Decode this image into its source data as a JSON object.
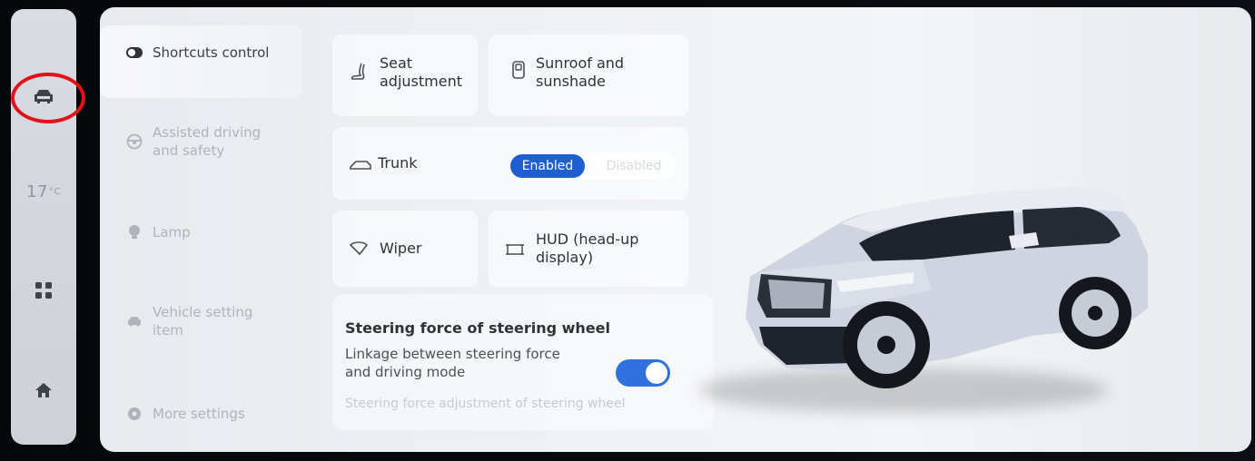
{
  "rail": {
    "temperature": "17",
    "temperature_unit": "°C",
    "items": [
      {
        "name": "car-icon",
        "selected": true
      },
      {
        "name": "temperature"
      },
      {
        "name": "apps-grid-icon"
      },
      {
        "name": "home-icon"
      }
    ]
  },
  "menu": {
    "items": [
      {
        "label": "Shortcuts control",
        "icon": "toggle-icon",
        "active": true
      },
      {
        "label": "Assisted driving and safety",
        "icon": "steering-wheel-icon"
      },
      {
        "label": "Lamp",
        "icon": "lamp-icon"
      },
      {
        "label": "Vehicle setting item",
        "icon": "car-icon"
      },
      {
        "label": "More settings",
        "icon": "gear-icon"
      }
    ]
  },
  "shortcuts": {
    "seat": "Seat adjustment",
    "sunroof": "Sunroof and sunshade",
    "trunk": "Trunk",
    "trunk_enabled": "Enabled",
    "trunk_disabled": "Disabled",
    "wiper": "Wiper",
    "hud": "HUD (head-up display)"
  },
  "steering": {
    "title": "Steering force of steering wheel",
    "linkage": "Linkage between steering force and driving mode",
    "linkage_on": true,
    "adjustment": "Steering force adjustment of steering wheel"
  },
  "colors": {
    "accent": "#1d5fd0",
    "toggle": "#2f72df",
    "annotation": "#e0131b"
  }
}
